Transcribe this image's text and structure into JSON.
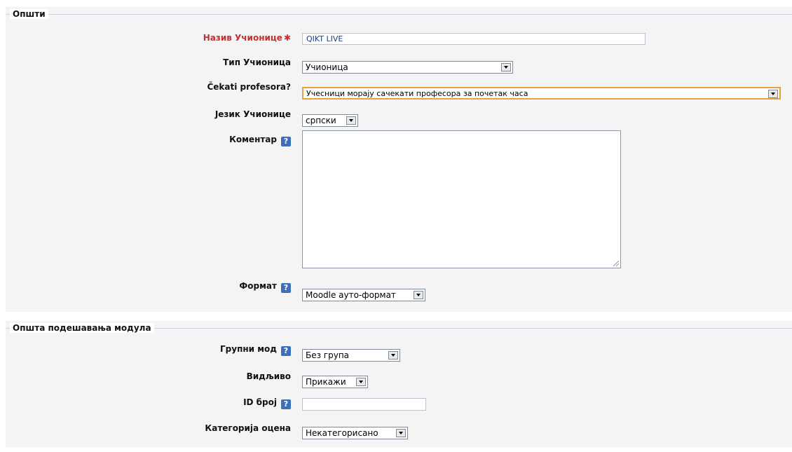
{
  "general": {
    "legend": "Општи",
    "fields": {
      "name": {
        "label": "Назив Учионице",
        "required_mark": "✱",
        "value": "QIKT LIVE"
      },
      "type": {
        "label": "Тип Учионица",
        "value": "Учионица"
      },
      "wait": {
        "label": "Čekati profesora?",
        "value": "Учесници морају сачекати професора за почетак часа"
      },
      "language": {
        "label": "Језик Учионице",
        "value": "српски"
      },
      "comment": {
        "label": "Коментар",
        "help": "?",
        "value": ""
      },
      "format": {
        "label": "Формат",
        "help": "?",
        "value": "Moodle ауто-формат"
      }
    }
  },
  "modules": {
    "legend": "Општа подешавања модула",
    "fields": {
      "group_mode": {
        "label": "Групни мод",
        "help": "?",
        "value": "Без група"
      },
      "visible": {
        "label": "Видљиво",
        "value": "Прикажи"
      },
      "id_number": {
        "label": "ID број",
        "help": "?",
        "value": ""
      },
      "grade_category": {
        "label": "Категорија оцена",
        "value": "Некатегорисано"
      }
    }
  },
  "colors": {
    "required": "#c43131",
    "help_bg": "#3c6fb7",
    "focus_border": "#e6a23c"
  },
  "icons": {
    "help": "help-icon",
    "dropdown": "chevron-down-icon",
    "required": "required-star-icon"
  }
}
